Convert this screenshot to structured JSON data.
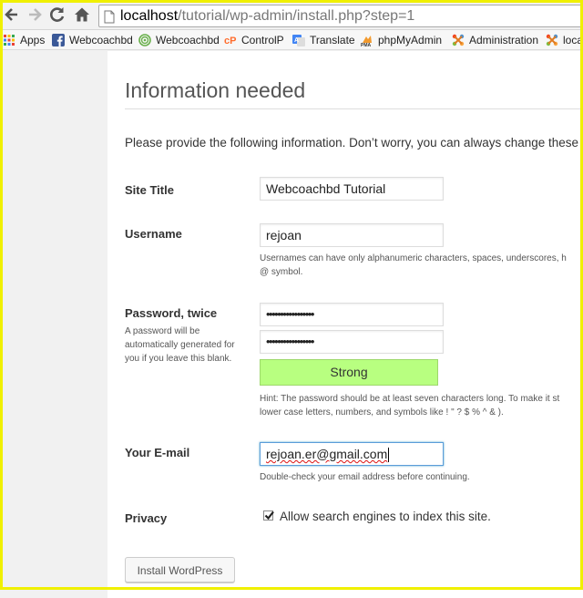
{
  "browser": {
    "address": {
      "host": "localhost",
      "path": "/tutorial/wp-admin/install.php?step=1"
    },
    "bookmarks": [
      {
        "label": "Apps",
        "icon": "apps-grid-icon"
      },
      {
        "label": "Webcoachbd",
        "icon": "facebook-icon"
      },
      {
        "label": "Webcoachbd",
        "icon": "target-icon"
      },
      {
        "label": "ControlP",
        "icon": "cpanel-icon"
      },
      {
        "label": "Translate",
        "icon": "translate-icon"
      },
      {
        "label": "phpMyAdmin",
        "icon": "phpmyadmin-icon"
      },
      {
        "label": "Administration",
        "icon": "joomla-icon"
      },
      {
        "label": "loca",
        "icon": "joomla-icon"
      }
    ]
  },
  "page": {
    "title": "Information needed",
    "intro": "Please provide the following information. Don’t worry, you can always change these",
    "site_title": {
      "label": "Site Title",
      "value": "Webcoachbd Tutorial"
    },
    "username": {
      "label": "Username",
      "value": "rejoan",
      "hint_line1": "Usernames can have only alphanumeric characters, spaces, underscores, h",
      "hint_line2": "@ symbol."
    },
    "password": {
      "label": "Password, twice",
      "sublabel": "A password will be automatically generated for you if you leave this blank.",
      "value1": "•••••••••••••••••",
      "value2": "•••••••••••••••••",
      "strength": "Strong",
      "hint_line1": "Hint: The password should be at least seven characters long. To make it st",
      "hint_line2": "lower case letters, numbers, and symbols like ! \" ? $ % ^ & )."
    },
    "email": {
      "label": "Your E-mail",
      "value": "rejoan.er@gmail.com",
      "hint": "Double-check your email address before continuing."
    },
    "privacy": {
      "label": "Privacy",
      "checkbox_label": "Allow search engines to index this site.",
      "checked": true
    },
    "install_button": "Install WordPress"
  },
  "colors": {
    "frame": "#f0f000",
    "strength_bg": "#b8ff80",
    "focus_border": "#5b9dd9"
  }
}
